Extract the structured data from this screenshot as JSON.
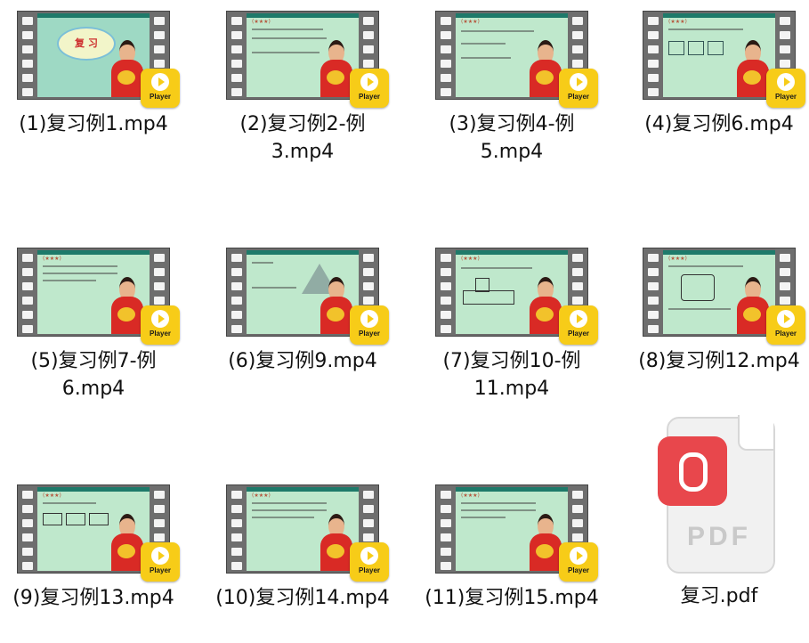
{
  "files": [
    {
      "name": "(1)复习例1.mp4",
      "variant": "title",
      "badge": "Player"
    },
    {
      "name": "(2)复习例2-例3.mp4",
      "variant": "slide",
      "badge": "Player"
    },
    {
      "name": "(3)复习例4-例5.mp4",
      "variant": "slide",
      "badge": "Player"
    },
    {
      "name": "(4)复习例6.mp4",
      "variant": "slide",
      "badge": "Player"
    },
    {
      "name": "(5)复习例7-例6.mp4",
      "variant": "slide",
      "badge": "Player"
    },
    {
      "name": "(6)复习例9.mp4",
      "variant": "slide",
      "badge": "Player"
    },
    {
      "name": "(7)复习例10-例11.mp4",
      "variant": "slide",
      "badge": "Player"
    },
    {
      "name": "(8)复习例12.mp4",
      "variant": "slide",
      "badge": "Player"
    },
    {
      "name": "(9)复习例13.mp4",
      "variant": "slide",
      "badge": "Player"
    },
    {
      "name": "(10)复习例14.mp4",
      "variant": "slide",
      "badge": "Player"
    },
    {
      "name": "(11)复习例15.mp4",
      "variant": "slide",
      "badge": "Player"
    },
    {
      "name": "复习.pdf",
      "variant": "pdf"
    }
  ],
  "title_slide_text": "复 习",
  "slide_stars": "(★★★)",
  "pdf_icon_text": "PDF"
}
